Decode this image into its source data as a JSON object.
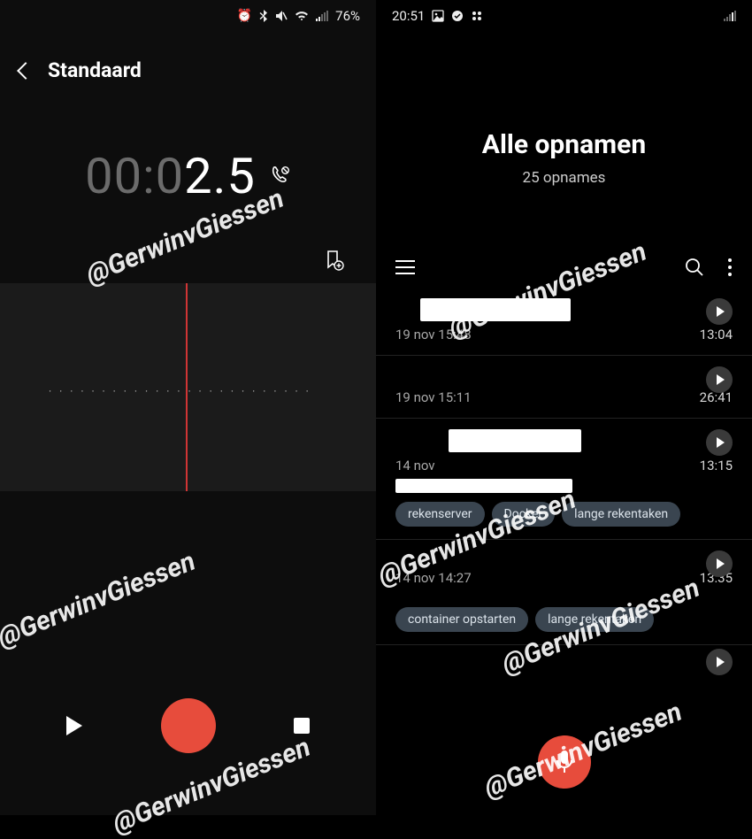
{
  "left": {
    "status": {
      "battery": "76%"
    },
    "header": {
      "title": "Standaard"
    },
    "timer": {
      "dim": "00:0",
      "bright": "2.5"
    }
  },
  "right": {
    "status": {
      "time": "20:51"
    },
    "title": "Alle opnamen",
    "subtitle": "25 opnames",
    "recordings": [
      {
        "date": "19 nov 15:48",
        "duration": "13:04"
      },
      {
        "date": "19 nov 15:11",
        "duration": "26:41"
      },
      {
        "date": "14 nov",
        "duration": "13:15",
        "tags": [
          "rekenserver",
          "Docker",
          "lange rekentaken"
        ]
      },
      {
        "date": "14 nov 14:27",
        "duration": "13:35",
        "tags": [
          "container opstarten",
          "lange rekentaken"
        ]
      }
    ]
  },
  "watermark": "@GerwinvGiessen"
}
